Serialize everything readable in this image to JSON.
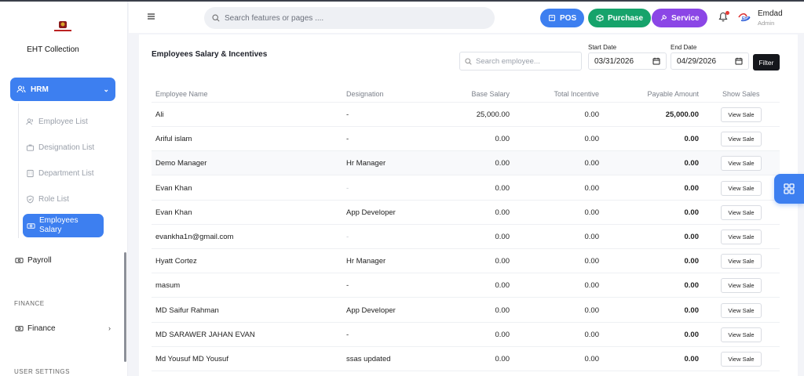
{
  "brand": {
    "name": "EHT Collection"
  },
  "sidebar": {
    "hrm": {
      "label": "HRM"
    },
    "hrm_items": [
      {
        "label": "Employee List"
      },
      {
        "label": "Designation List"
      },
      {
        "label": "Department List"
      },
      {
        "label": "Role List"
      }
    ],
    "active_item": {
      "line1": "Employees",
      "line2": "Salary"
    },
    "payroll": {
      "label": "Payroll"
    },
    "finance_section": "FINANCE",
    "finance": {
      "label": "Finance"
    },
    "user_settings_section": "USER SETTINGS"
  },
  "header": {
    "search_placeholder": "Search features or pages ....",
    "buttons": {
      "pos": "POS",
      "purchase": "Purchase",
      "service": "Service"
    },
    "user": {
      "name": "Emdad",
      "role": "Admin"
    },
    "colors": {
      "pos": "#3d7ff0",
      "purchase": "#16a36b",
      "service": "#8b46e6"
    }
  },
  "page": {
    "title": "Employees Salary & Incentives",
    "search_placeholder": "Search employee...",
    "start_label": "Start Date",
    "start_value": "03/31/2026",
    "end_label": "End Date",
    "end_value": "04/29/2026",
    "filter_label": "Filter"
  },
  "table": {
    "headers": {
      "name": "Employee Name",
      "designation": "Designation",
      "base": "Base Salary",
      "incentive": "Total Incentive",
      "payable": "Payable Amount",
      "show": "Show Sales"
    },
    "view_label": "View Sale",
    "rows": [
      {
        "name": "Ali",
        "designation": "-",
        "base": "25,000.00",
        "incentive": "0.00",
        "payable": "25,000.00"
      },
      {
        "name": "Ariful islam",
        "designation": "-",
        "base": "0.00",
        "incentive": "0.00",
        "payable": "0.00"
      },
      {
        "name": "Demo Manager",
        "designation": "Hr Manager",
        "base": "0.00",
        "incentive": "0.00",
        "payable": "0.00"
      },
      {
        "name": "Evan Khan",
        "designation": "-",
        "base": "0.00",
        "incentive": "0.00",
        "payable": "0.00"
      },
      {
        "name": "Evan Khan",
        "designation": "App Developer",
        "base": "0.00",
        "incentive": "0.00",
        "payable": "0.00"
      },
      {
        "name": "evankha1n@gmail.com",
        "designation": "-",
        "base": "0.00",
        "incentive": "0.00",
        "payable": "0.00"
      },
      {
        "name": "Hyatt Cortez",
        "designation": "Hr Manager",
        "base": "0.00",
        "incentive": "0.00",
        "payable": "0.00"
      },
      {
        "name": "masum",
        "designation": "-",
        "base": "0.00",
        "incentive": "0.00",
        "payable": "0.00"
      },
      {
        "name": "MD Saifur Rahman",
        "designation": "App Developer",
        "base": "0.00",
        "incentive": "0.00",
        "payable": "0.00"
      },
      {
        "name": "MD SARAWER JAHAN EVAN",
        "designation": "-",
        "base": "0.00",
        "incentive": "0.00",
        "payable": "0.00"
      },
      {
        "name": "Md Yousuf MD Yousuf",
        "designation": "ssas updated",
        "base": "0.00",
        "incentive": "0.00",
        "payable": "0.00"
      }
    ]
  }
}
